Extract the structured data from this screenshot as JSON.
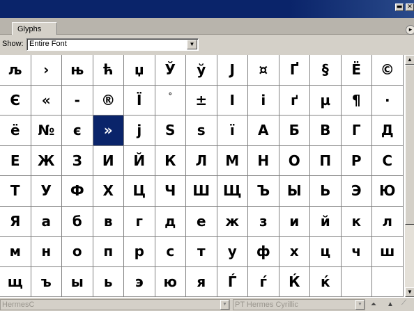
{
  "panel": {
    "tab_label": "Glyphs",
    "show_label": "Show:",
    "show_value": "Entire Font"
  },
  "glyph_rows": [
    [
      "љ",
      "›",
      "њ",
      "ћ",
      "џ",
      "Ў",
      "ў",
      "Ј",
      "¤",
      "Ґ",
      "§",
      "Ё",
      "©"
    ],
    [
      "Є",
      "«",
      "-",
      "®",
      "Ї",
      "°",
      "±",
      "І",
      "і",
      "ґ",
      "µ",
      "¶",
      "·"
    ],
    [
      "ё",
      "№",
      "є",
      "»",
      "ј",
      "Ѕ",
      "ѕ",
      "ї",
      "А",
      "Б",
      "В",
      "Г",
      "Д"
    ],
    [
      "Е",
      "Ж",
      "З",
      "И",
      "Й",
      "К",
      "Л",
      "М",
      "Н",
      "О",
      "П",
      "Р",
      "С"
    ],
    [
      "Т",
      "У",
      "Ф",
      "Х",
      "Ц",
      "Ч",
      "Ш",
      "Щ",
      "Ъ",
      "Ы",
      "Ь",
      "Э",
      "Ю"
    ],
    [
      "Я",
      "а",
      "б",
      "в",
      "г",
      "д",
      "е",
      "ж",
      "з",
      "и",
      "й",
      "к",
      "л"
    ],
    [
      "м",
      "н",
      "о",
      "п",
      "р",
      "с",
      "т",
      "у",
      "ф",
      "х",
      "ц",
      "ч",
      "ш"
    ],
    [
      "щ",
      "ъ",
      "ы",
      "ь",
      "э",
      "ю",
      "я",
      "Ѓ",
      "ѓ",
      "Ќ",
      "ќ",
      "",
      ""
    ]
  ],
  "selected_glyph": "»",
  "status": {
    "font_family": "HermesC",
    "font_style": "PT Hermes Cyrillic"
  },
  "colors": {
    "selection": "#0a246a",
    "title_bar": "#0a246a"
  },
  "icons": {
    "minimize": "minimize-icon",
    "close": "close-icon",
    "panel_menu": "panel-menu-icon",
    "zoom_out": "zoom-out-icon",
    "zoom_in": "zoom-in-icon"
  }
}
